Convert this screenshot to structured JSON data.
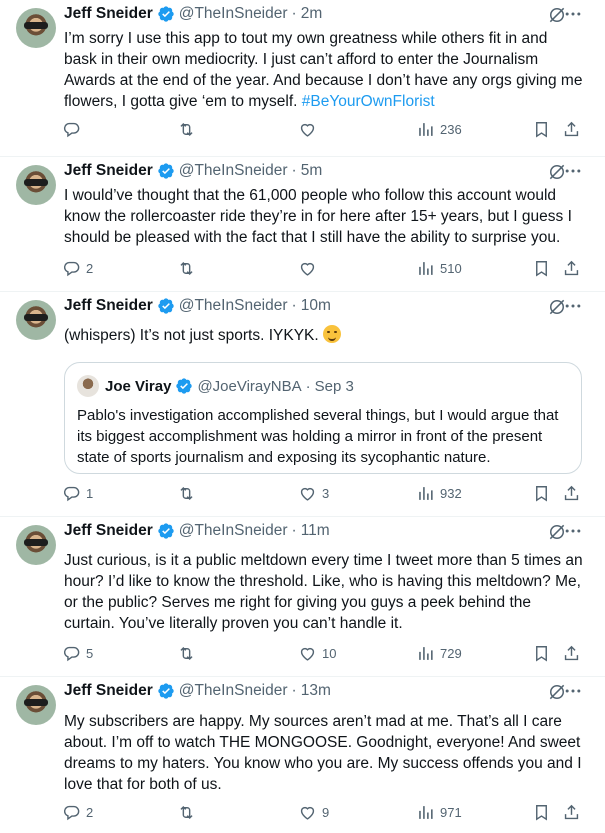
{
  "tweets": [
    {
      "name": "Jeff Sneider",
      "handle": "@TheInSneider",
      "time": "2m",
      "text": "I’m sorry I use this app to tout my own greatness while others fit in and bask in their own mediocrity. I just can’t afford to enter the Journalism Awards at the end of the year. And because I don’t have any orgs giving me flowers, I gotta give ‘em to myself. ",
      "hashtag": "#BeYourOwnFlorist",
      "replies": "",
      "retweets": "",
      "likes": "",
      "views": "236"
    },
    {
      "name": "Jeff Sneider",
      "handle": "@TheInSneider",
      "time": "5m",
      "text": "I would’ve thought that the 61,000 people who follow this account would know the rollercoaster ride they’re in for here after 15+ years, but I guess I should be pleased with the fact that I still have the ability to surprise you.",
      "replies": "2",
      "retweets": "",
      "likes": "",
      "views": "510"
    },
    {
      "name": "Jeff Sneider",
      "handle": "@TheInSneider",
      "time": "10m",
      "text": "(whispers) It’s not just sports. IYKYK. ",
      "emoji": "smiling-face-emoji",
      "quote": {
        "name": "Joe Viray",
        "handle": "@JoeVirayNBA",
        "time": "Sep 3",
        "text": "Pablo's investigation accomplished several things, but I would argue that its biggest accomplishment was holding a mirror in front of the present state of sports journalism and exposing its sycophantic nature."
      },
      "replies": "1",
      "retweets": "",
      "likes": "3",
      "views": "932"
    },
    {
      "name": "Jeff Sneider",
      "handle": "@TheInSneider",
      "time": "11m",
      "text": "Just curious, is it a public meltdown every time I tweet more than 5 times an hour? I’d like to know the threshold. Like, who is having this meltdown? Me, or the public? Serves me right for giving you guys a peek behind the curtain. You’ve literally proven you can’t handle it.",
      "replies": "5",
      "retweets": "",
      "likes": "10",
      "views": "729"
    },
    {
      "name": "Jeff Sneider",
      "handle": "@TheInSneider",
      "time": "13m",
      "text": "My subscribers are happy. My sources aren’t mad at me. That’s all I care about. I’m off to watch THE MONGOOSE. Goodnight, everyone! And sweet dreams to my haters. You know who you are. My success offends you and I love that for both of us.",
      "replies": "2",
      "retweets": "",
      "likes": "9",
      "views": "971"
    }
  ],
  "colors": {
    "text": "#0f1419",
    "secondary": "#536471",
    "accent": "#1d9bf0",
    "divider": "#eff3f4",
    "verified": "#1d9bf0"
  },
  "separator": "·"
}
